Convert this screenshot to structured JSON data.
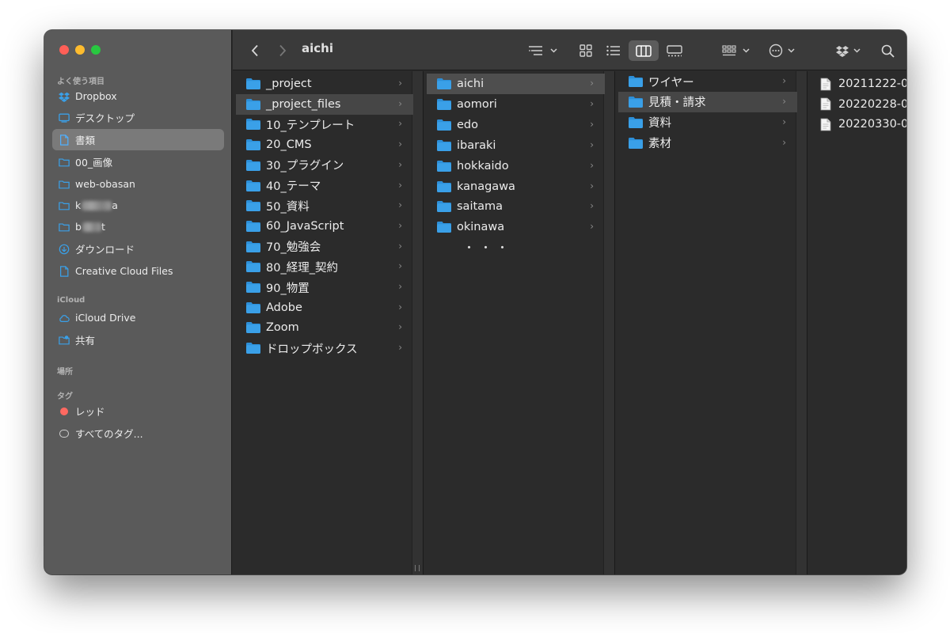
{
  "colors": {
    "close": "#ff5f57",
    "minimize": "#febc2e",
    "zoom": "#28c840",
    "folder_blue": "#3aa0e8",
    "tag_red": "#ff6961"
  },
  "sidebar": {
    "sections": {
      "favorites": "よく使う項目",
      "icloud": "iCloud",
      "locations": "場所",
      "tags": "タグ"
    },
    "favorites": [
      {
        "label": "Dropbox",
        "icon": "dropbox-icon"
      },
      {
        "label": "デスクトップ",
        "icon": "desktop-icon"
      },
      {
        "label": "書類",
        "icon": "document-icon",
        "selected": true
      },
      {
        "label": "00_画像",
        "icon": "folder-icon"
      },
      {
        "label": "web-obasan",
        "icon": "folder-icon"
      },
      {
        "label": "k",
        "suffix": "a",
        "icon": "folder-icon",
        "redacted": true
      },
      {
        "label": "b",
        "suffix": "t",
        "icon": "folder-icon",
        "redacted": true
      },
      {
        "label": "ダウンロード",
        "icon": "download-icon"
      },
      {
        "label": "Creative Cloud Files",
        "icon": "document-icon"
      }
    ],
    "icloud": [
      {
        "label": "iCloud Drive",
        "icon": "cloud-icon"
      },
      {
        "label": "共有",
        "icon": "shared-folder-icon"
      }
    ],
    "tags": [
      {
        "label": "レッド",
        "icon": "red-tag-icon"
      },
      {
        "label": "すべてのタグ...",
        "icon": "all-tags-icon"
      }
    ]
  },
  "toolbar": {
    "title": "aichi",
    "icons": [
      "back-icon",
      "forward-icon",
      "sort-icon",
      "icon-view-icon",
      "list-view-icon",
      "column-view-icon",
      "gallery-view-icon",
      "group-icon",
      "more-icon",
      "dropbox-icon",
      "search-icon"
    ]
  },
  "columns": [
    {
      "items": [
        {
          "label": "_project",
          "type": "folder"
        },
        {
          "label": "_project_files",
          "type": "folder",
          "state": "highlight"
        },
        {
          "label": "10_テンプレート",
          "type": "folder"
        },
        {
          "label": "20_CMS",
          "type": "folder"
        },
        {
          "label": "30_プラグイン",
          "type": "folder"
        },
        {
          "label": "40_テーマ",
          "type": "folder"
        },
        {
          "label": "50_資料",
          "type": "folder"
        },
        {
          "label": "60_JavaScript",
          "type": "folder"
        },
        {
          "label": "70_勉強会",
          "type": "folder"
        },
        {
          "label": "80_経理_契約",
          "type": "folder"
        },
        {
          "label": "90_物置",
          "type": "folder"
        },
        {
          "label": "Adobe",
          "type": "folder"
        },
        {
          "label": "Zoom",
          "type": "folder"
        },
        {
          "label": "ドロップボックス",
          "type": "folder"
        }
      ]
    },
    {
      "items": [
        {
          "label": "aichi",
          "type": "folder",
          "state": "selected"
        },
        {
          "label": "aomori",
          "type": "folder"
        },
        {
          "label": "edo",
          "type": "folder"
        },
        {
          "label": "ibaraki",
          "type": "folder"
        },
        {
          "label": "hokkaido",
          "type": "folder"
        },
        {
          "label": "kanagawa",
          "type": "folder"
        },
        {
          "label": "saitama",
          "type": "folder"
        },
        {
          "label": "okinawa",
          "type": "folder"
        }
      ],
      "more": "・・・"
    },
    {
      "items": [
        {
          "label": "ワイヤー",
          "type": "folder"
        },
        {
          "label": "見積・請求",
          "type": "folder",
          "state": "highlight"
        },
        {
          "label": "資料",
          "type": "folder"
        },
        {
          "label": "素材",
          "type": "folder"
        }
      ]
    },
    {
      "items": [
        {
          "label": "20211222-0",
          "type": "file"
        },
        {
          "label": "20220228-0",
          "type": "file"
        },
        {
          "label": "20220330-0",
          "type": "file"
        }
      ]
    }
  ]
}
